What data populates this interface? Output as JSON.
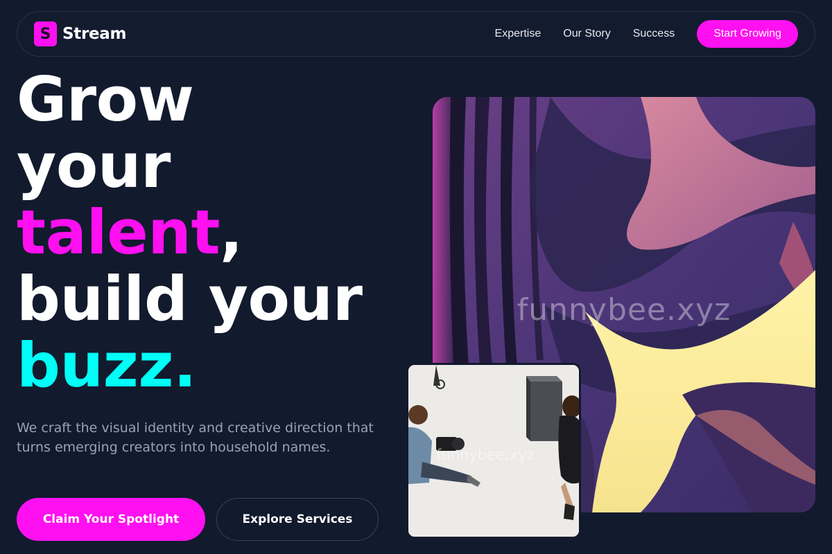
{
  "nav": {
    "logo_letter": "S",
    "brand": "Stream",
    "links": [
      "Expertise",
      "Our Story",
      "Success"
    ],
    "cta": "Start Growing"
  },
  "hero": {
    "headline": {
      "line1": "Grow",
      "line2": "your",
      "line3_accent": "talent",
      "line3_tail": ",",
      "line4": "build your",
      "line5": "buzz."
    },
    "subcopy": "We craft the visual identity and creative direction that turns emerging creators into household names.",
    "primary_button": "Claim Your Spotlight",
    "secondary_button": "Explore Services"
  },
  "images": {
    "art_watermark": "funnybee.xyz",
    "photo_watermark": "funnybee.xyz"
  },
  "colors": {
    "accent": "#ff10f0",
    "accent_secondary": "#00fff7",
    "background": "#121a2d"
  }
}
